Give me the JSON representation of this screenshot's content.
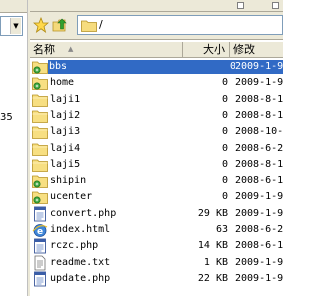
{
  "left_panel": {
    "number": "35"
  },
  "toolbar": {
    "path": "/"
  },
  "columns": {
    "name": "名称",
    "size": "大小",
    "modified": "修改"
  },
  "files": [
    {
      "name": "bbs",
      "size": "0",
      "date": "2009-1-9",
      "icon": "folder-special-icon",
      "selected": true
    },
    {
      "name": "home",
      "size": "0",
      "date": "2009-1-9",
      "icon": "folder-special-icon",
      "selected": false
    },
    {
      "name": "laji1",
      "size": "0",
      "date": "2008-8-1",
      "icon": "folder-icon",
      "selected": false
    },
    {
      "name": "laji2",
      "size": "0",
      "date": "2008-8-1",
      "icon": "folder-icon",
      "selected": false
    },
    {
      "name": "laji3",
      "size": "0",
      "date": "2008-10-",
      "icon": "folder-icon",
      "selected": false
    },
    {
      "name": "laji4",
      "size": "0",
      "date": "2008-6-2",
      "icon": "folder-icon",
      "selected": false
    },
    {
      "name": "laji5",
      "size": "0",
      "date": "2008-8-1",
      "icon": "folder-icon",
      "selected": false
    },
    {
      "name": "shipin",
      "size": "0",
      "date": "2008-6-1",
      "icon": "folder-special-icon",
      "selected": false
    },
    {
      "name": "ucenter",
      "size": "0",
      "date": "2009-1-9",
      "icon": "folder-special-icon",
      "selected": false
    },
    {
      "name": "convert.php",
      "size": "29 KB",
      "date": "2009-1-9",
      "icon": "php-file-icon",
      "selected": false
    },
    {
      "name": "index.html",
      "size": "63",
      "date": "2008-6-2",
      "icon": "ie-html-file-icon",
      "selected": false
    },
    {
      "name": "rczc.php",
      "size": "14 KB",
      "date": "2008-6-1",
      "icon": "php-file-icon",
      "selected": false
    },
    {
      "name": "readme.txt",
      "size": "1 KB",
      "date": "2009-1-9",
      "icon": "text-file-icon",
      "selected": false
    },
    {
      "name": "update.php",
      "size": "22 KB",
      "date": "2009-1-9",
      "icon": "php-file-icon",
      "selected": false
    }
  ]
}
